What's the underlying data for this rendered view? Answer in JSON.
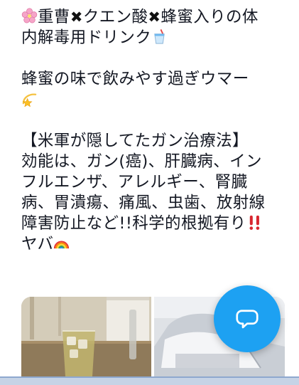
{
  "tweet": {
    "lines": [
      {
        "text_a": "重曹",
        "text_b": "クエン酸",
        "text_c": "蜂蜜入りの体"
      },
      {
        "text": "内解毒用ドリンク"
      },
      {
        "text": ""
      },
      {
        "text": "蜂蜜の味で飲みやす過ぎウマー"
      },
      {
        "text": ""
      },
      {
        "text": ""
      },
      {
        "text": "【米軍が隠してたガン治療法】"
      },
      {
        "text": "効能は、ガン(癌)、肝臓病、イン"
      },
      {
        "text": "フルエンザ、アレルギー、腎臓"
      },
      {
        "text": "病、胃潰瘍、痛風、虫歯、放射線"
      },
      {
        "text": "障害防止など!!科学的根拠有り"
      },
      {
        "text": "ヤバ"
      }
    ],
    "cross_glyph": "✖",
    "emojis": [
      "cherry-blossom",
      "cup-with-straw",
      "dizzy",
      "double-exclamation",
      "rainbow"
    ]
  },
  "media": {
    "photos": [
      "glass-of-drink-photo",
      "white-powder-photo"
    ]
  },
  "fab": {
    "icon": "compose-reply-icon",
    "color": "#1da1f2"
  }
}
